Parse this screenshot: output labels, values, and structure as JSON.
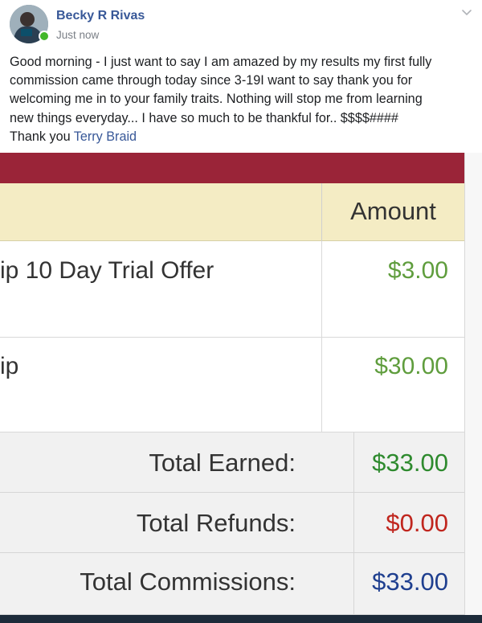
{
  "post": {
    "author": "Becky R Rivas",
    "timestamp": "Just now",
    "body_lines": [
      "Good morning - I just want to say I am amazed by my results my first fully",
      "commission came through today since 3-19I want to say thank you for",
      "welcoming me in to your family traits. Nothing will stop me from learning",
      "new things everyday... I have so much to be thankful for.. $$$$####",
      "Thank you "
    ],
    "mention": "Terry Braid"
  },
  "table": {
    "header_amount": "Amount",
    "items": [
      {
        "name": "ip 10 Day Trial Offer",
        "amount": "$3.00"
      },
      {
        "name": "ip",
        "amount": "$30.00"
      }
    ],
    "totals": [
      {
        "label": "Total Earned:",
        "amount": "$33.00",
        "color": "#2e8a2e"
      },
      {
        "label": "Total Refunds:",
        "amount": "$0.00",
        "color": "#c0261e"
      },
      {
        "label": "Total Commissions:",
        "amount": "$33.00",
        "color": "#1f3f8f"
      }
    ]
  },
  "colors": {
    "link": "#385898",
    "header_bar": "#9a2438",
    "item_amount": "#5f9d3d",
    "online": "#42b72a"
  },
  "icons": {
    "chevron": "chevron-down-icon",
    "online": "online-status-icon"
  }
}
